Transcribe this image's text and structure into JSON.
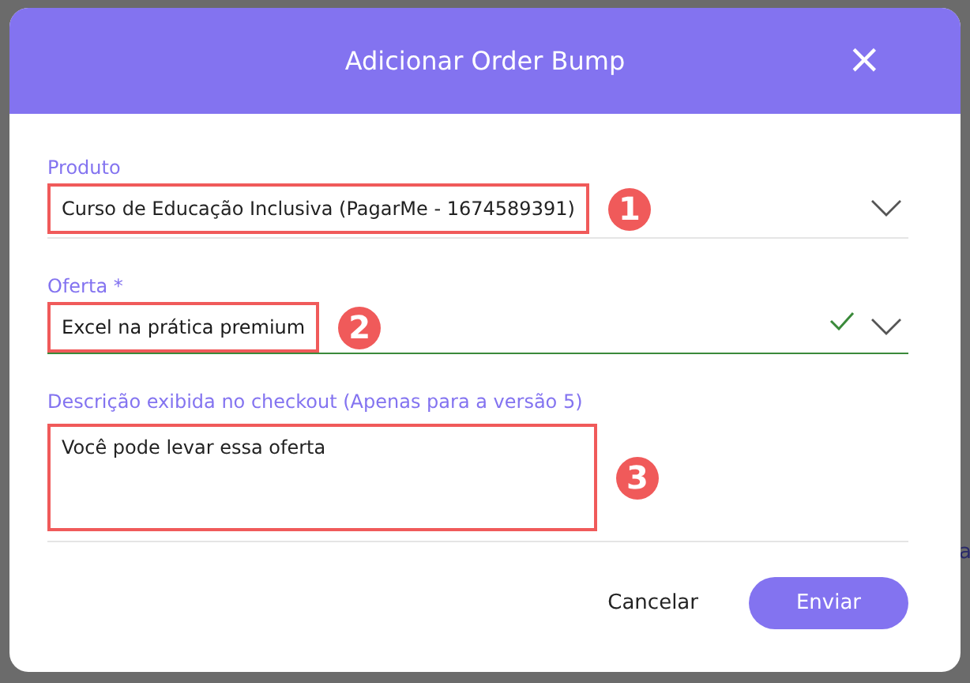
{
  "dialog": {
    "title": "Adicionar Order Bump",
    "close": "×"
  },
  "fields": [
    {
      "kind": "select",
      "label": "Produto",
      "value": "Curso de Educação Inclusiva (PagarMe - 1674589391)",
      "valid": false,
      "marker": "1"
    },
    {
      "kind": "select",
      "label": "Oferta *",
      "value": "Excel na prática premium",
      "valid": true,
      "marker": "2"
    },
    {
      "kind": "textarea",
      "label": "Descrição exibida no checkout (Apenas para a versão 5)",
      "value": "Você pode levar essa oferta",
      "marker": "3"
    }
  ],
  "buttons": [
    {
      "label": "Cancelar",
      "kind": "text"
    },
    {
      "label": "Enviar",
      "kind": "primary"
    }
  ],
  "background_text": "a"
}
